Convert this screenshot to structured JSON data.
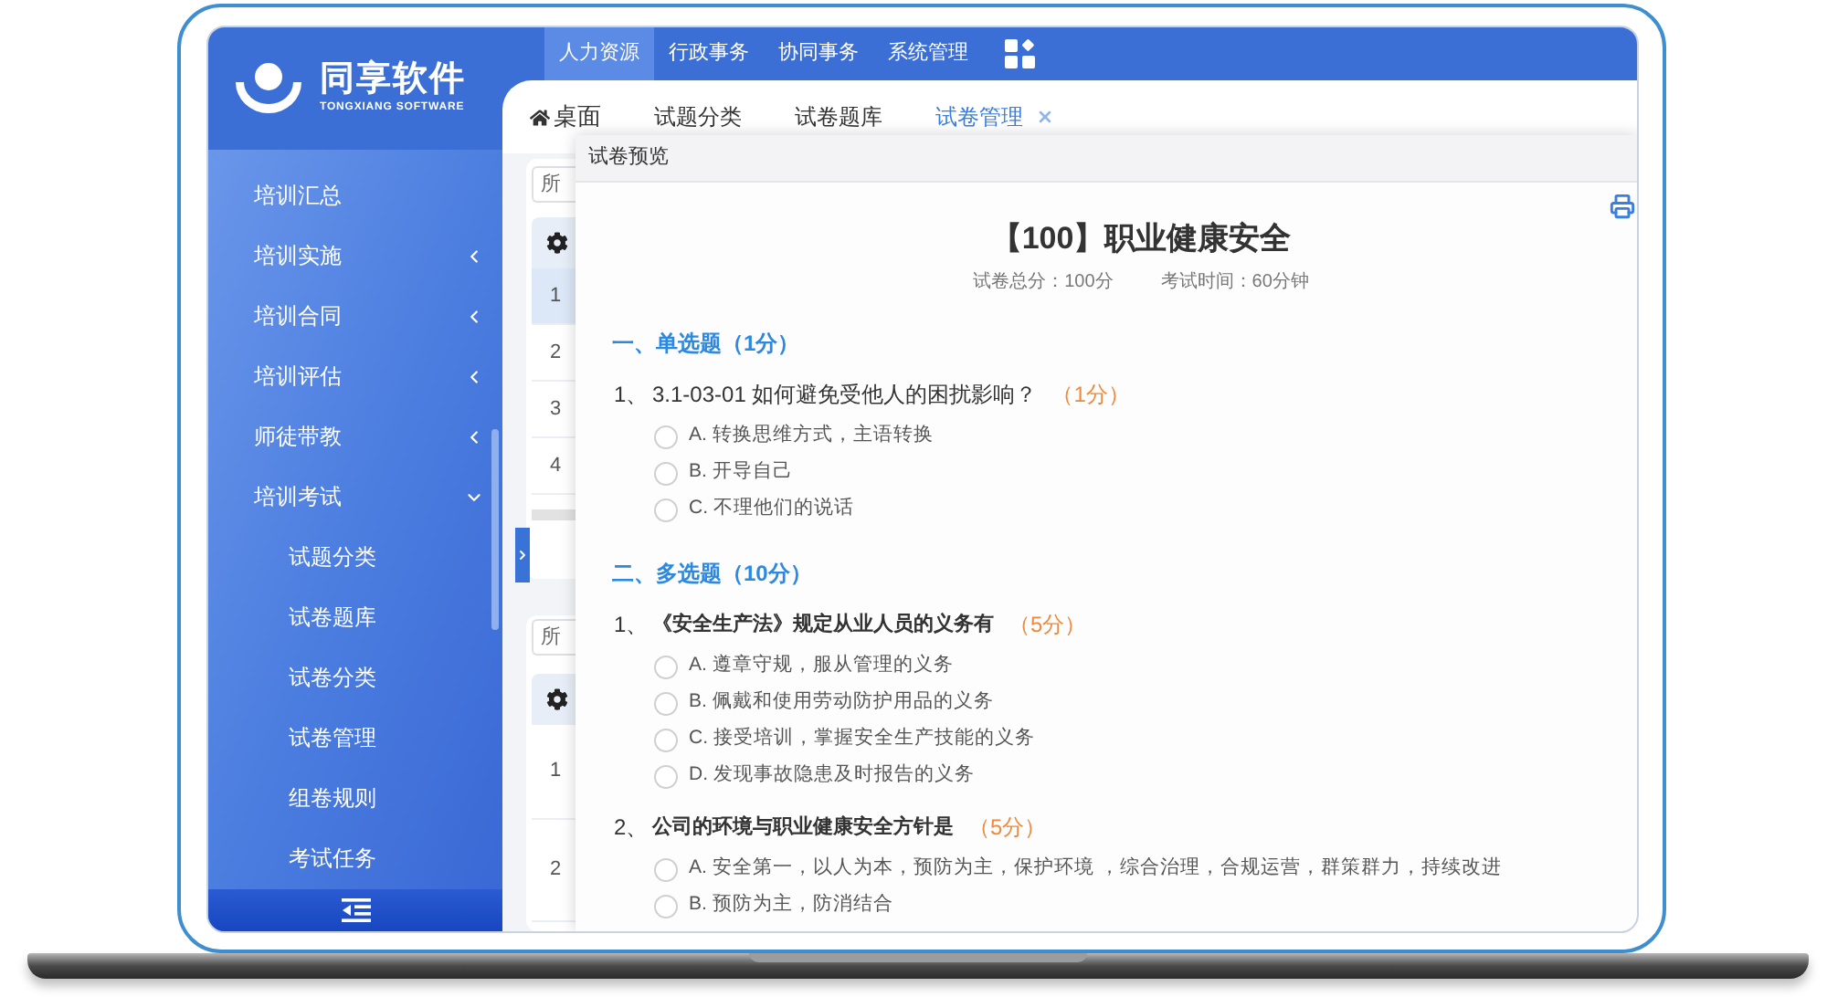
{
  "logo": {
    "name": "同享软件",
    "tagline": "TONGXIANG SOFTWARE"
  },
  "top_nav": [
    {
      "label": "人力资源",
      "selected": true
    },
    {
      "label": "行政事务",
      "selected": false
    },
    {
      "label": "协同事务",
      "selected": false
    },
    {
      "label": "系统管理",
      "selected": false
    }
  ],
  "sidebar": {
    "items": [
      {
        "label": "培训汇总",
        "kind": "link"
      },
      {
        "label": "培训实施",
        "kind": "group",
        "expanded": false
      },
      {
        "label": "培训合同",
        "kind": "group",
        "expanded": false
      },
      {
        "label": "培训评估",
        "kind": "group",
        "expanded": false
      },
      {
        "label": "师徒带教",
        "kind": "group",
        "expanded": false
      },
      {
        "label": "培训考试",
        "kind": "group",
        "expanded": true,
        "children": [
          {
            "label": "试题分类"
          },
          {
            "label": "试卷题库"
          },
          {
            "label": "试卷分类"
          },
          {
            "label": "试卷管理"
          },
          {
            "label": "组卷规则"
          },
          {
            "label": "考试任务"
          }
        ]
      }
    ]
  },
  "tabs": [
    {
      "label": "桌面",
      "kind": "home",
      "selected": false,
      "closable": false
    },
    {
      "label": "试题分类",
      "kind": "page",
      "selected": false,
      "closable": false
    },
    {
      "label": "试卷题库",
      "kind": "page",
      "selected": false,
      "closable": false
    },
    {
      "label": "试卷管理",
      "kind": "page",
      "selected": true,
      "closable": true
    }
  ],
  "background_list": {
    "panels": [
      {
        "filter": "所",
        "rows": [
          {
            "index": "1",
            "selected": true
          },
          {
            "index": "2",
            "selected": false
          },
          {
            "index": "3",
            "selected": false
          },
          {
            "index": "4",
            "selected": false
          }
        ]
      },
      {
        "filter": "所",
        "rows": [
          {
            "index": "1",
            "selected": false
          },
          {
            "index": "2",
            "selected": false
          }
        ]
      }
    ]
  },
  "preview_dialog": {
    "title": "试卷预览",
    "paper_title": "【100】职业健康安全",
    "total_score": "试卷总分：100分",
    "exam_time": "考试时间：60分钟",
    "sections": [
      {
        "heading": "一、单选题（1分）",
        "kind": "single_choice",
        "questions": [
          {
            "number": "1、",
            "text": "3.1-03-01 如何避免受他人的困扰影响？",
            "score": "（1分）",
            "options": [
              {
                "text": "A. 转换思维方式，主语转换",
                "checked": false
              },
              {
                "text": "B. 开导自己",
                "checked": false
              },
              {
                "text": "C. 不理他们的说话",
                "checked": false
              }
            ]
          }
        ]
      },
      {
        "heading": "二、多选题（10分）",
        "kind": "multiple_choice",
        "questions": [
          {
            "number": "1、",
            "text": "《安全生产法》规定从业人员的义务有",
            "score": "（5分）",
            "options": [
              {
                "text": "A. 遵章守规，服从管理的义务",
                "checked": false
              },
              {
                "text": "B. 佩戴和使用劳动防护用品的义务",
                "checked": false
              },
              {
                "text": "C. 接受培训，掌握安全生产技能的义务",
                "checked": false
              },
              {
                "text": "D. 发现事故隐患及时报告的义务",
                "checked": false
              }
            ]
          },
          {
            "number": "2、",
            "text": "公司的环境与职业健康安全方针是",
            "score": "（5分）",
            "options": [
              {
                "text": "A. 安全第一，以人为本，预防为主，保护环境 ，综合治理，合规运营，群策群力，持续改进",
                "checked": false
              },
              {
                "text": "B. 预防为主，防消结合",
                "checked": false
              }
            ]
          }
        ]
      }
    ]
  }
}
